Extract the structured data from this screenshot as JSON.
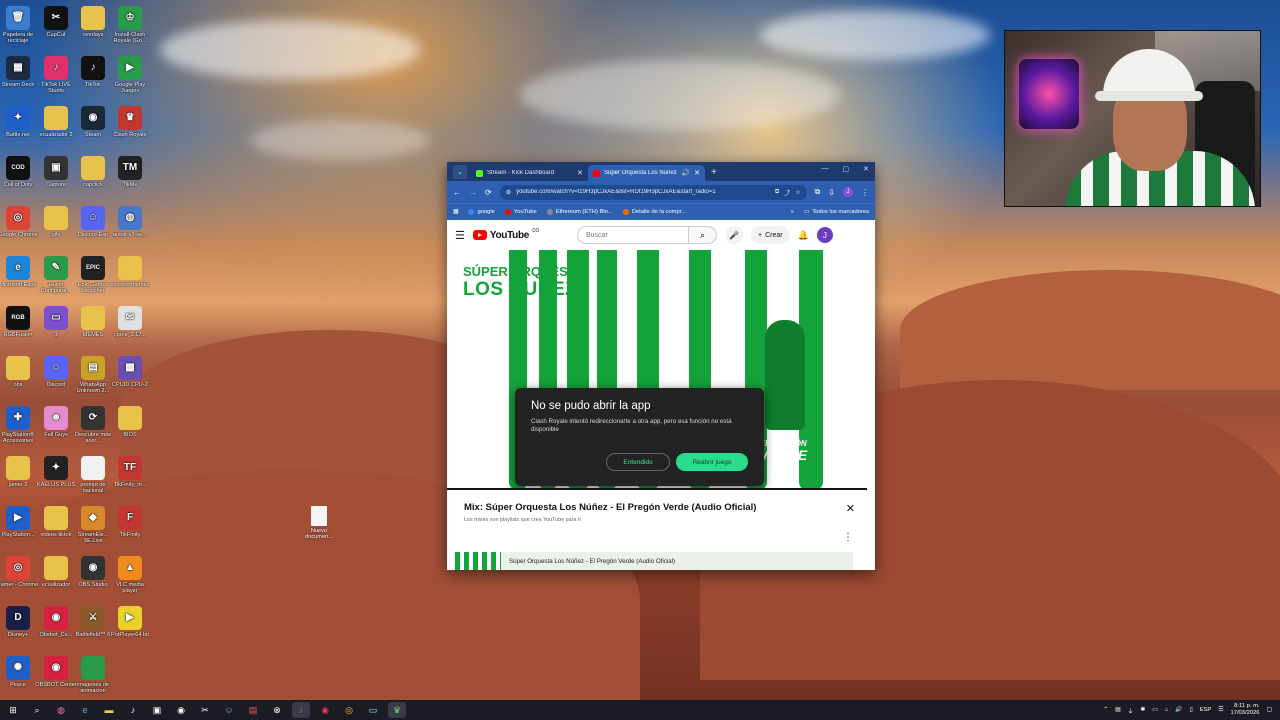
{
  "desktop": {
    "icons": [
      {
        "label": "Papelera de reciclaje",
        "glyph": "🗑",
        "color": "#3b7ecf"
      },
      {
        "label": "CapCut",
        "glyph": "✂",
        "color": "#111111"
      },
      {
        "label": "overlays",
        "glyph": "",
        "color": "#e9c24c"
      },
      {
        "label": "Install-Clash Royale (Go...",
        "glyph": "♔",
        "color": "#2a9a4b"
      },
      {
        "label": "Stream Deck",
        "glyph": "▦",
        "color": "#1f2a44"
      },
      {
        "label": "TikTok LIVE Studio",
        "glyph": "♪",
        "color": "#e1306c"
      },
      {
        "label": "TikTok",
        "glyph": "♪",
        "color": "#111111"
      },
      {
        "label": "Google Play Juegos",
        "glyph": "▶",
        "color": "#2a9a4b"
      },
      {
        "label": "Battle.net",
        "glyph": "✦",
        "color": "#1e5fc9"
      },
      {
        "label": "ecualizador 2",
        "glyph": "",
        "color": "#e9c24c"
      },
      {
        "label": "Steam",
        "glyph": "◉",
        "color": "#1b2838"
      },
      {
        "label": "Clash Royale",
        "glyph": "♛",
        "color": "#c2372f"
      },
      {
        "label": "Call of Duty",
        "glyph": "COD",
        "color": "#111111"
      },
      {
        "label": "Capture",
        "glyph": "▣",
        "color": "#333333"
      },
      {
        "label": "capclick",
        "glyph": "",
        "color": "#e9c24c"
      },
      {
        "label": "TikMe",
        "glyph": "TM",
        "color": "#222222"
      },
      {
        "label": "Google Chrome",
        "glyph": "◎",
        "color": "#db4437"
      },
      {
        "label": "gifs",
        "glyph": "",
        "color": "#e9c24c"
      },
      {
        "label": "Discord-Esp",
        "glyph": "☺",
        "color": "#5865f2"
      },
      {
        "label": "autoit-v3-se...",
        "glyph": "◍",
        "color": "#4a78c9"
      },
      {
        "label": "Microsoft Edge",
        "glyph": "e",
        "color": "#1a86d8"
      },
      {
        "label": "Huion Configurat...",
        "glyph": "✎",
        "color": "#2a9a4b"
      },
      {
        "label": "Epic Games Launcher",
        "glyph": "EPIC",
        "color": "#222222"
      },
      {
        "label": "sonidos memes",
        "glyph": "",
        "color": "#e9c24c"
      },
      {
        "label": "RGBFusion",
        "glyph": "RGB",
        "color": "#111111"
      },
      {
        "label": "1",
        "glyph": "▭",
        "color": "#7a4fd0"
      },
      {
        "label": "MEMES",
        "glyph": "",
        "color": "#e9c24c"
      },
      {
        "label": "cpu-z_2.17...",
        "glyph": "✉",
        "color": "#e0e0e0"
      },
      {
        "label": "obs",
        "glyph": "",
        "color": "#e9c24c"
      },
      {
        "label": "Discord",
        "glyph": "☺",
        "color": "#5865f2"
      },
      {
        "label": "WhatsApp Unknown 2...",
        "glyph": "▤",
        "color": "#c9a227"
      },
      {
        "label": "CPUID CPU-Z",
        "glyph": "▩",
        "color": "#6a4fb0"
      },
      {
        "label": "PlayStation® Accessories",
        "glyph": "✚",
        "color": "#1e5fc9"
      },
      {
        "label": "Fall Guys",
        "glyph": "☻",
        "color": "#e58bd0"
      },
      {
        "label": "Descubre más acer...",
        "glyph": "⟳",
        "color": "#333333"
      },
      {
        "label": "BIOS",
        "glyph": "",
        "color": "#e9c24c"
      },
      {
        "label": "jamer 2",
        "glyph": "",
        "color": "#e9c24c"
      },
      {
        "label": "KAELUS PLUS",
        "glyph": "✦",
        "color": "#222222"
      },
      {
        "label": "prompt de nacional",
        "glyph": "",
        "color": "#f0f0f0"
      },
      {
        "label": "TikFinity_in...",
        "glyph": "TF",
        "color": "#c2372f"
      },
      {
        "label": "PlayStation...",
        "glyph": "▶",
        "color": "#1e5fc9"
      },
      {
        "label": "videos tiktok",
        "glyph": "",
        "color": "#e9c24c"
      },
      {
        "label": "StreamEle... SE.Live",
        "glyph": "◆",
        "color": "#d88a2a"
      },
      {
        "label": "TikFinity",
        "glyph": "F",
        "color": "#c2372f"
      },
      {
        "label": "Jamer - Chrome",
        "glyph": "◎",
        "color": "#db4437"
      },
      {
        "label": "ecualizador",
        "glyph": "",
        "color": "#e9c24c"
      },
      {
        "label": "OBS Studio",
        "glyph": "◉",
        "color": "#333333"
      },
      {
        "label": "VLC media player",
        "glyph": "▲",
        "color": "#f08a1c"
      },
      {
        "label": "Disney+",
        "glyph": "D",
        "color": "#1a1f4a"
      },
      {
        "label": "Obsbot_Ce...",
        "glyph": "◉",
        "color": "#d62040"
      },
      {
        "label": "Battlefield™ 6",
        "glyph": "⚔",
        "color": "#8a5a2a"
      },
      {
        "label": "PotPlayer64 bit",
        "glyph": "▶",
        "color": "#e8d22a"
      },
      {
        "label": "Peace",
        "glyph": "✺",
        "color": "#1e5fc9"
      },
      {
        "label": "OBSBOT Center",
        "glyph": "◉",
        "color": "#d62040"
      },
      {
        "label": "imagenes de animacion",
        "glyph": "",
        "color": "#2a9a4b"
      }
    ],
    "file": {
      "label": "Nuevo documen..."
    }
  },
  "browser": {
    "tabs": [
      {
        "title": "Stream - Kick Dashboard",
        "active": false,
        "icon_color": "#53fc18"
      },
      {
        "title": "Súper Orquesta Los Nuñez",
        "active": true,
        "icon_color": "#ff0000"
      }
    ],
    "url": "youtube.com/watch?v=t19H3pCJxAE&list=RDt19H3pCJxAE&start_radio=1",
    "bookmarks": [
      {
        "label": "google",
        "color": "#4285f4"
      },
      {
        "label": "YouTube",
        "color": "#ff0000"
      },
      {
        "label": "Ethereum (ETH) Blo...",
        "color": "#8a8a8a"
      },
      {
        "label": "Detalle de la compr...",
        "color": "#ff6a00"
      }
    ],
    "all_bookmarks": "Todos los marcadores"
  },
  "youtube": {
    "logo": "YouTube",
    "logo_sup": "CO",
    "search_placeholder": "Buscar",
    "create_label": "Crear",
    "avatar_initial": "J",
    "video": {
      "title_line1": "SÚPER ORQUESTA",
      "title_line2": "LOS NUÑEZ",
      "badge_line1": "EL PREGÓN",
      "badge_line2": "VERDE"
    },
    "dialog": {
      "title": "No se pudo abrir la app",
      "message": "Clash Royale intentó redireccionarte a otra app, pero esa función no está disponible",
      "dismiss": "Entendido",
      "reopen": "Reabrir juego"
    },
    "mix": {
      "title": "Mix: Súper Orquesta Los Núñez - El Pregón Verde (Audio Oficial)",
      "subtitle": "Los mixes son playlists que crea YouTube para ti",
      "item": "Súper Orquesta Los Núñez - El Pregón Verde (Audio Oficial)"
    }
  },
  "taskbar": {
    "language": "ESP",
    "time": "8:11 p. m.",
    "date": "17/03/2026"
  }
}
